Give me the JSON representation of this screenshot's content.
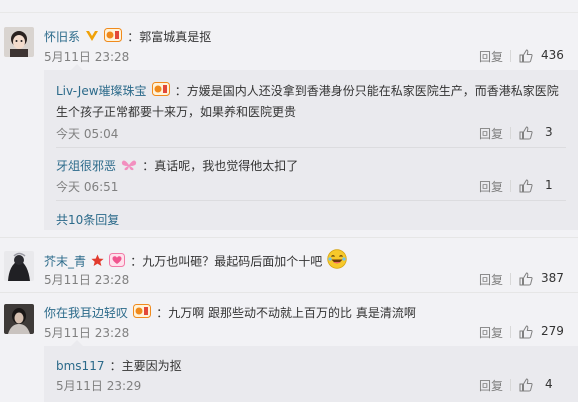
{
  "comments": [
    {
      "user": "怀旧系",
      "text": "：郭富城真是抠",
      "time": "5月11日 23:28",
      "reply_label": "回复",
      "likes": "436",
      "replies": [
        {
          "user": "Liv-Jew璀璨珠宝",
          "text_line1": "：方媛是国内人还没拿到香港身份只能在私家医院生产，而香港私家医院",
          "text_line2": "生个孩子正常都要十来万，如果养和医院更贵",
          "time": "今天 05:04",
          "reply_label": "回复",
          "likes": "3"
        },
        {
          "user": "牙俎很邪恶",
          "text": "：真话呢，我也觉得他太扣了",
          "time": "今天 06:51",
          "reply_label": "回复",
          "likes": "1"
        }
      ],
      "more_label": "共10条回复"
    },
    {
      "user": "芥末_青",
      "text": "：九万也叫砸？最起码后面加个十吧",
      "time": "5月11日 23:28",
      "reply_label": "回复",
      "likes": "387"
    },
    {
      "user": "你在我耳边轻叹",
      "text": "：九万啊 跟那些动不动就上百万的比 真是清流啊",
      "time": "5月11日 23:28",
      "reply_label": "回复",
      "likes": "279",
      "replies": [
        {
          "user": "bms117",
          "text": "：主要因为抠",
          "time": "5月11日 23:29",
          "reply_label": "回复",
          "likes": "4"
        }
      ]
    }
  ],
  "colors": {
    "username": "#2b6a8a",
    "meta": "#808080",
    "background": "#f2f2f5",
    "reply_background": "#eaeaee"
  }
}
